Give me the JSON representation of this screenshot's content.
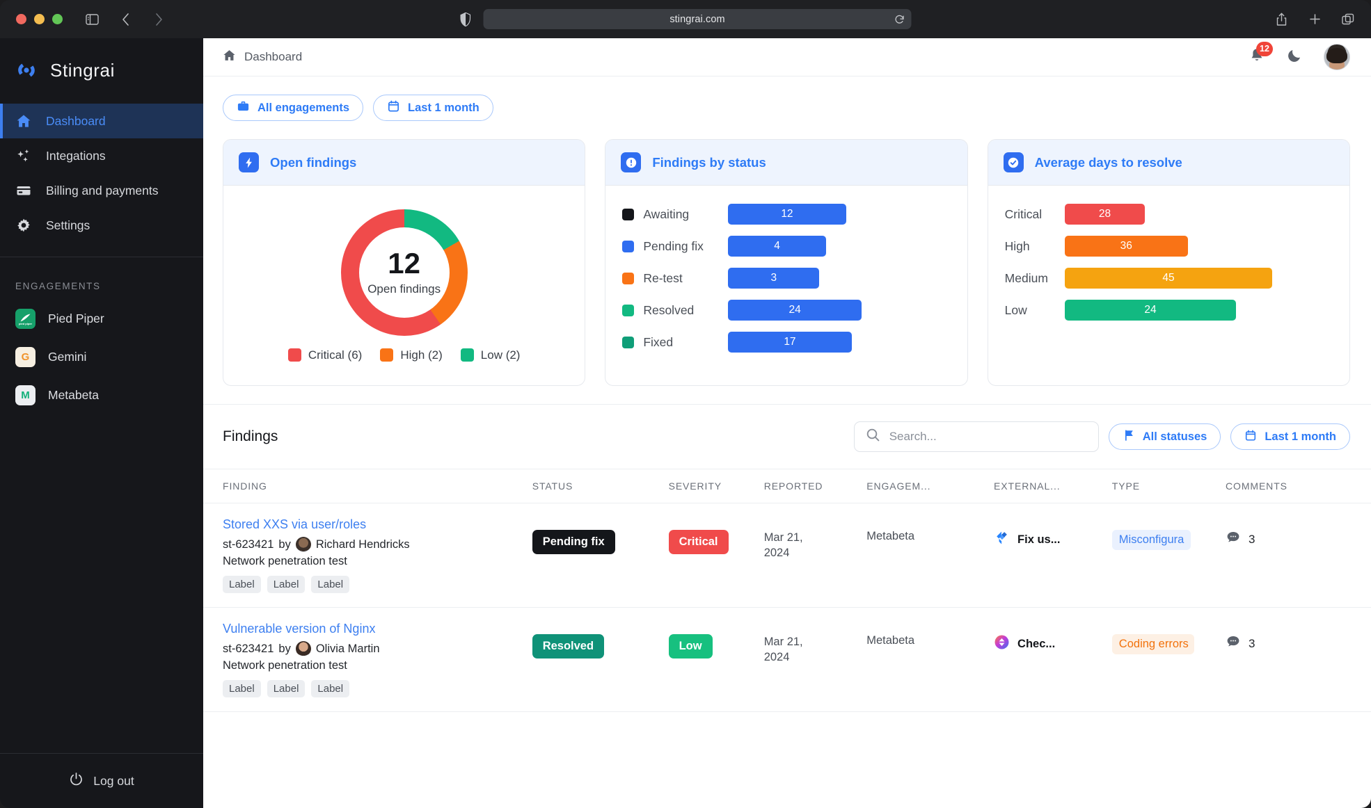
{
  "browser": {
    "url": "stingrai.com",
    "icons": [
      "sidebar-toggle-icon",
      "back-icon",
      "forward-icon",
      "shield-icon",
      "reload-icon",
      "share-icon",
      "new-tab-icon",
      "tabs-icon"
    ]
  },
  "sidebar": {
    "brand": "Stingrai",
    "nav": [
      {
        "label": "Dashboard",
        "icon": "home-icon",
        "active": true
      },
      {
        "label": "Integations",
        "icon": "sparkle-icon",
        "active": false
      },
      {
        "label": "Billing and payments",
        "icon": "credit-card-icon",
        "active": false
      },
      {
        "label": "Settings",
        "icon": "gear-icon",
        "active": false
      }
    ],
    "section_title": "ENGAGEMENTS",
    "engagements": [
      {
        "label": "Pied Piper",
        "initial": "",
        "bg": "#16a06a",
        "fg": "#ffffff"
      },
      {
        "label": "Gemini",
        "initial": "G",
        "bg": "#f6efe2",
        "fg": "#f0932b"
      },
      {
        "label": "Metabeta",
        "initial": "M",
        "bg": "#eceef1",
        "fg": "#11b07a"
      }
    ],
    "logout": "Log out"
  },
  "topbar": {
    "breadcrumb": "Dashboard",
    "notifications_count": "12",
    "theme_icon": "moon-icon",
    "avatar": "user-avatar"
  },
  "filters": {
    "engagements_chip": "All engagements",
    "date_chip": "Last 1 month"
  },
  "cards": {
    "open_findings": {
      "title": "Open findings",
      "icon": "bolt-icon",
      "center_value": "12",
      "center_label": "Open findings"
    },
    "findings_by_status": {
      "title": "Findings by status",
      "icon": "alert-icon"
    },
    "avg_days": {
      "title": "Average days to resolve",
      "icon": "check-circle-icon"
    }
  },
  "chart_data": [
    {
      "type": "pie",
      "title": "Open findings",
      "center_value": 12,
      "center_label": "Open findings",
      "categories": [
        "Critical",
        "High",
        "Low"
      ],
      "values": [
        6,
        2,
        2
      ],
      "legend": [
        "Critical (6)",
        "High (2)",
        "Low (2)"
      ],
      "colors": [
        "#f04b4b",
        "#f97316",
        "#12b981"
      ],
      "legend_position": "bottom",
      "note": "donut; green Low 0-60deg, orange High 60-145deg, red Critical 145-360deg"
    },
    {
      "type": "bar",
      "title": "Findings by status",
      "orientation": "horizontal",
      "categories": [
        "Awaiting",
        "Pending fix",
        "Re-test",
        "Resolved",
        "Fixed"
      ],
      "values": [
        12,
        4,
        3,
        24,
        17
      ],
      "bar_color": "#2f6df0",
      "marker_colors": [
        "#14161a",
        "#2f6df0",
        "#f97316",
        "#12b981",
        "#0f9e78"
      ],
      "xlabel": "",
      "ylabel": "",
      "grid": false
    },
    {
      "type": "bar",
      "title": "Average days to resolve",
      "orientation": "horizontal",
      "categories": [
        "Critical",
        "High",
        "Medium",
        "Low"
      ],
      "values": [
        28,
        36,
        45,
        24
      ],
      "colors": [
        "#f04b4b",
        "#f97316",
        "#f5a310",
        "#12b981"
      ],
      "xlabel": "",
      "ylabel": "",
      "grid": false
    }
  ],
  "findings": {
    "title": "Findings",
    "search_placeholder": "Search...",
    "search_value": "",
    "status_chip": "All statuses",
    "date_chip": "Last 1 month",
    "columns": [
      "FINDING",
      "STATUS",
      "SEVERITY",
      "REPORTED",
      "ENGAGEM...",
      "EXTERNAL...",
      "TYPE",
      "COMMENTS"
    ],
    "rows": [
      {
        "title": "Stored XXS via user/roles",
        "id": "st-623421",
        "by": "by",
        "author": "Richard Hendricks",
        "subtitle": "Network penetration test",
        "labels": [
          "Label",
          "Label",
          "Label"
        ],
        "status": "Pending fix",
        "status_color": "#14161a",
        "severity": "Critical",
        "severity_color": "#f04b4b",
        "reported": "Mar 21,\n2024",
        "engagement": "Metabeta",
        "external_icon": "jira-icon",
        "external": "Fix us...",
        "type": "Misconfigura",
        "type_style": "blue",
        "comments": "3"
      },
      {
        "title": "Vulnerable version of Nginx",
        "id": "st-623421",
        "by": "by",
        "author": "Olivia Martin",
        "subtitle": "Network penetration test",
        "labels": [
          "Label",
          "Label",
          "Label"
        ],
        "status": "Resolved",
        "status_color": "#0f9278",
        "severity": "Low",
        "severity_color": "#17c07f",
        "reported": "Mar 21,\n2024",
        "engagement": "Metabeta",
        "external_icon": "checkmarx-icon",
        "external": "Chec...",
        "type": "Coding errors",
        "type_style": "orange",
        "comments": "3"
      }
    ]
  }
}
